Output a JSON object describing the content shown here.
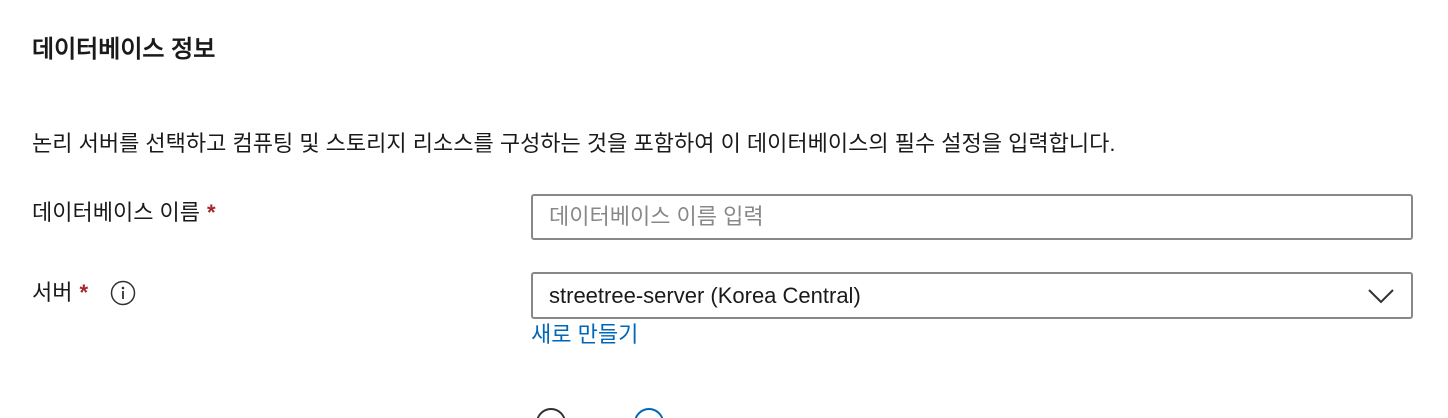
{
  "section": {
    "title": "데이터베이스 정보",
    "description": "논리 서버를 선택하고 컴퓨팅 및 스토리지 리소스를 구성하는 것을 포함하여 이 데이터베이스의 필수 설정을 입력합니다."
  },
  "fields": {
    "database_name": {
      "label": "데이터베이스 이름",
      "required_mark": "*",
      "value": "",
      "placeholder": "데이터베이스 이름 입력"
    },
    "server": {
      "label": "서버",
      "required_mark": "*",
      "info_icon": "info-icon",
      "selected": "streetree-server (Korea Central)",
      "create_new_label": "새로 만들기"
    }
  },
  "colors": {
    "text": "#1b1a19",
    "required": "#a4262c",
    "link": "#0067b8",
    "border": "#8a8886"
  }
}
